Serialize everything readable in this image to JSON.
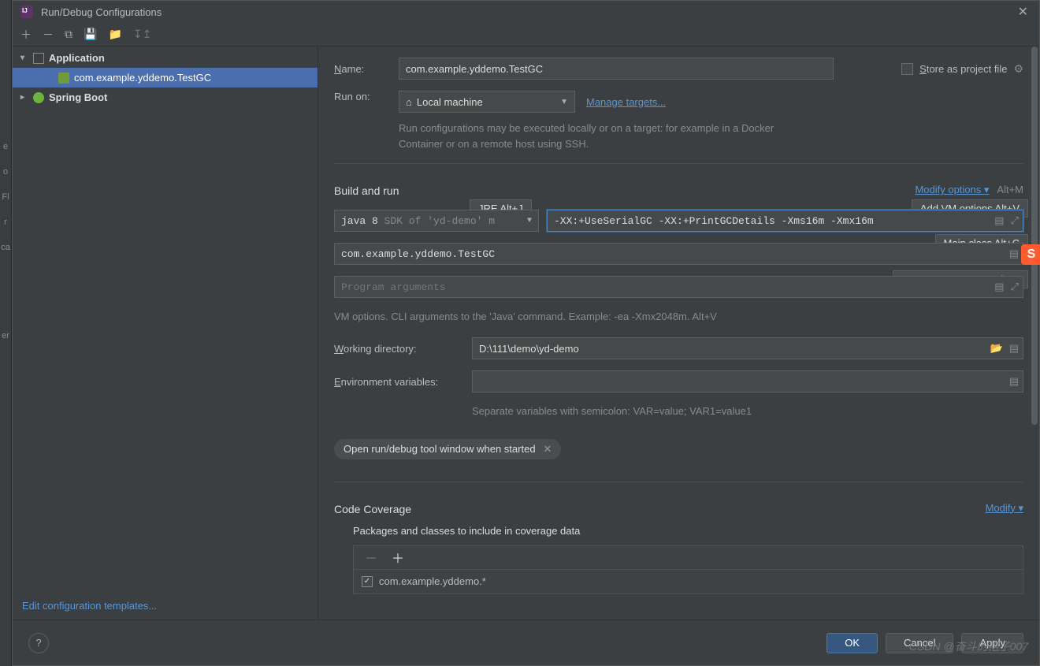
{
  "dialog": {
    "title": "Run/Debug Configurations"
  },
  "tree": {
    "application_label": "Application",
    "selected_config": "com.example.yddemo.TestGC",
    "spring_boot_label": "Spring Boot",
    "edit_templates": "Edit configuration templates..."
  },
  "form": {
    "name_label": "Name:",
    "name_value": "com.example.yddemo.TestGC",
    "store_label": "Store as project file",
    "run_on_label": "Run on:",
    "run_on_value": "Local machine",
    "manage_targets": "Manage targets...",
    "run_on_hint": "Run configurations may be executed locally or on a target: for example in a Docker Container or on a remote host using SSH.",
    "build_and_run": "Build and run",
    "modify_options": "Modify options",
    "modify_options_shortcut": "Alt+M",
    "jre_tooltip": "JRE Alt+J",
    "vm_tooltip": "Add VM options Alt+V",
    "mainclass_tooltip": "Main class Alt+C",
    "progargs_tooltip": "Program arguments Alt+R",
    "jdk_name": "java 8",
    "jdk_desc": "SDK of 'yd-demo' m",
    "vm_options": "-XX:+UseSerialGC -XX:+PrintGCDetails -Xms16m -Xmx16m",
    "main_class": "com.example.yddemo.TestGC",
    "program_args_placeholder": "Program arguments",
    "vm_hint": "VM options. CLI arguments to the 'Java' command. Example: -ea -Xmx2048m. Alt+V",
    "working_dir_label": "Working directory:",
    "working_dir": "D:\\111\\demo\\yd-demo",
    "env_label": "Environment variables:",
    "env_hint": "Separate variables with semicolon: VAR=value; VAR1=value1",
    "open_tool_window": "Open run/debug tool window when started",
    "code_coverage": "Code Coverage",
    "modify": "Modify",
    "packages_hint": "Packages and classes to include in coverage data",
    "coverage_item": "com.example.yddemo.*"
  },
  "buttons": {
    "ok": "OK",
    "cancel": "Cancel",
    "apply": "Apply"
  },
  "watermark": "CSDN @奋斗的袍子007"
}
